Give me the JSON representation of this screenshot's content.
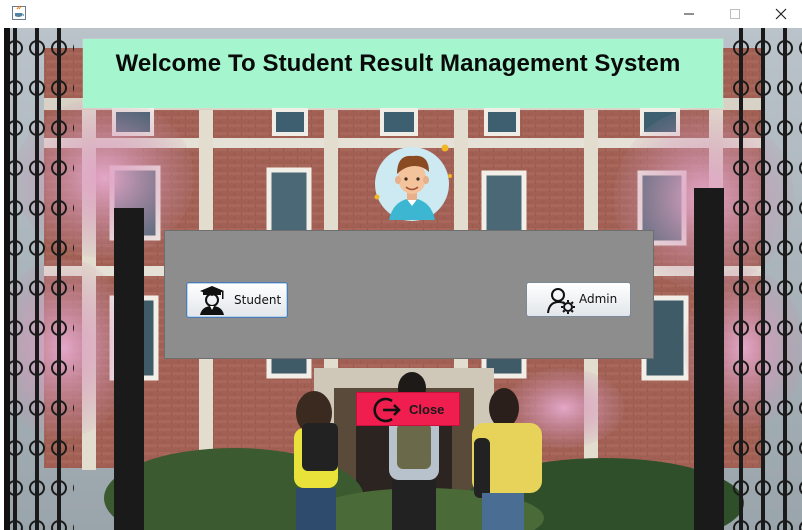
{
  "window": {
    "minimize_glyph": "—",
    "maximize_glyph": "☐",
    "close_glyph": "✕"
  },
  "banner": {
    "title": "Welcome To Student Result Management System",
    "background": "#a5f6cf"
  },
  "panel": {
    "background": "#8d8d8d"
  },
  "buttons": {
    "student": {
      "label": "Student",
      "icon": "graduate-icon"
    },
    "admin": {
      "label": "Admin",
      "icon": "user-settings-icon"
    },
    "close": {
      "label": "Close",
      "icon": "logout-icon",
      "color": "#f01e4f"
    }
  },
  "avatar": {
    "icon": "student-avatar-icon"
  }
}
